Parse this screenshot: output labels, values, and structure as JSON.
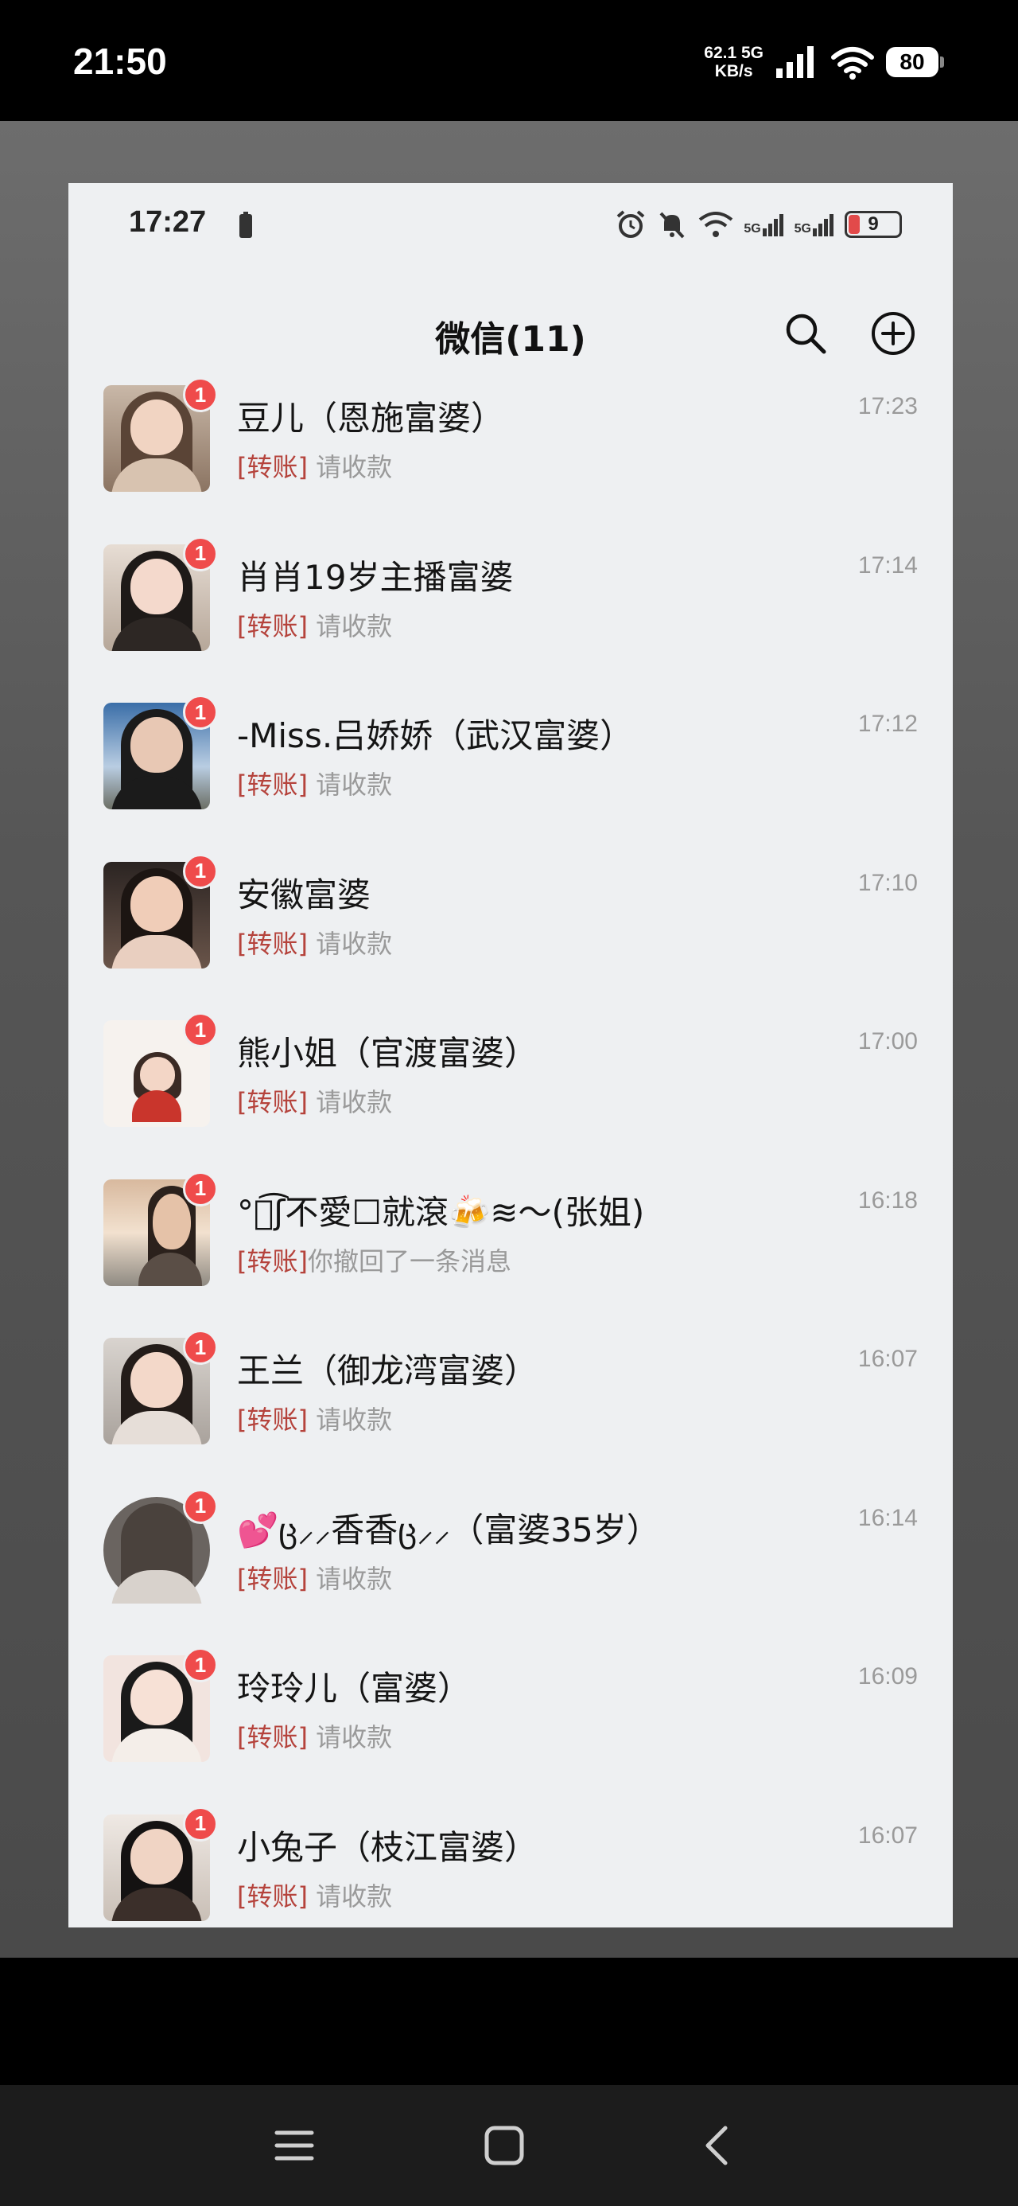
{
  "outer_status": {
    "time": "21:50",
    "net_speed_value": "62.1",
    "net_speed_unit": "KB/s",
    "network_label": "5G",
    "battery": "80"
  },
  "inner_status": {
    "time": "17:27",
    "network_label_1": "5G",
    "network_label_2": "5G",
    "battery": "9"
  },
  "header": {
    "title": "微信(11)"
  },
  "chats": [
    {
      "name": "豆儿（恩施富婆）",
      "time": "17:23",
      "tag": "[转账]",
      "preview": "请收款",
      "badge": "1"
    },
    {
      "name": "肖肖19岁主播富婆",
      "time": "17:14",
      "tag": "[转账]",
      "preview": "请收款",
      "badge": "1"
    },
    {
      "name": "-Miss.吕娇娇（武汉富婆）",
      "time": "17:12",
      "tag": "[转账]",
      "preview": "请收款",
      "badge": "1"
    },
    {
      "name": "安徽富婆",
      "time": "17:10",
      "tag": "[转账]",
      "preview": "请收款",
      "badge": "1"
    },
    {
      "name": "熊小姐（官渡富婆）",
      "time": "17:00",
      "tag": "[转账]",
      "preview": "请收款",
      "badge": "1"
    },
    {
      "name": "°ั͡ʃ不愛☐就滾🍻≋〜(张姐)",
      "time": "16:18",
      "tag": "[转账]",
      "preview": "你撤回了一条消息",
      "badge": "1"
    },
    {
      "name": "王兰（御龙湾富婆）",
      "time": "16:07",
      "tag": "[转账]",
      "preview": "请收款",
      "badge": "1"
    },
    {
      "name": "💕ც⸝⸝香香ც⸝⸝（富婆35岁）",
      "time": "16:14",
      "tag": "[转账]",
      "preview": "请收款",
      "badge": "1"
    },
    {
      "name": "玲玲儿（富婆）",
      "time": "16:09",
      "tag": "[转账]",
      "preview": "请收款",
      "badge": "1"
    },
    {
      "name": "小兔子（枝江富婆）",
      "time": "16:07",
      "tag": "[转账]",
      "preview": "请收款",
      "badge": "1"
    }
  ],
  "colors": {
    "badge": "#ef4b4b",
    "tag": "#b5433c",
    "card_bg": "#eef0f2"
  },
  "icons": {
    "header_search": "search-icon",
    "header_add": "add-circle-icon",
    "nav_menu": "menu-icon",
    "nav_home": "home-icon",
    "nav_back": "back-icon"
  }
}
